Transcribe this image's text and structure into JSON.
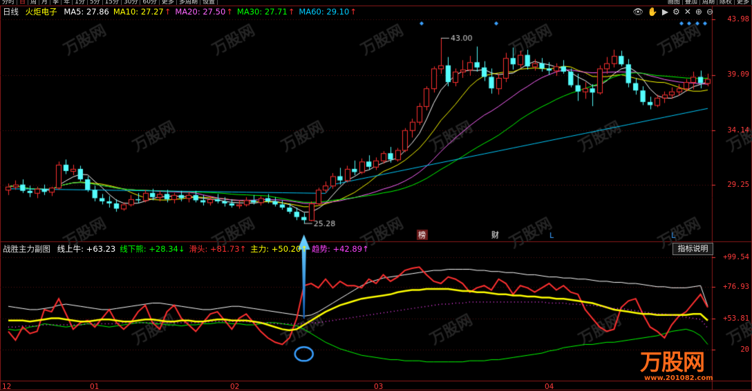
{
  "toolbar": {
    "tabs": [
      "分时",
      "日",
      "周",
      "月",
      "季",
      "年",
      "1分",
      "5分",
      "15分",
      "30分",
      "60分",
      "更多",
      "多周期",
      "设置"
    ],
    "active_index": 1,
    "right": [
      "画图",
      "叠加",
      "周期",
      "除权",
      "更多"
    ]
  },
  "main_panel": {
    "period_label": "日线",
    "stock_name": "火炬电子",
    "ma": [
      {
        "label": "MA5: 27.86",
        "color": "#ffffff"
      },
      {
        "label": "MA10: 27.27",
        "color": "#ffff00"
      },
      {
        "label": "MA20: 27.50",
        "color": "#ff66ff"
      },
      {
        "label": "MA30: 27.71",
        "color": "#00ff00"
      },
      {
        "label": "MA60: 29.10",
        "color": "#00ccff"
      }
    ],
    "up_arrow": "↑",
    "high_label": "43.00",
    "low_label": "25.28",
    "events": [
      "榜",
      "财",
      "L",
      "L"
    ],
    "y_ticks": [
      "43.98",
      "39.09",
      "34.14",
      "29.25"
    ]
  },
  "sub_panel": {
    "title": "战胜主力副图",
    "indicators": [
      {
        "label": "线上牛: +63.23",
        "color": "#ffffff"
      },
      {
        "label": "线下熊: +28.34",
        "color": "#00ff00",
        "arrow": "↓"
      },
      {
        "label": "滑头: +81.73",
        "color": "#ff3030",
        "arrow": "↑"
      },
      {
        "label": "主力: +50.20",
        "color": "#ffff00",
        "arrow": "↑"
      },
      {
        "label": "趋势: +42.89",
        "color": "#ff44ff",
        "arrow": "↑"
      }
    ],
    "help_button": "指标说明",
    "y_ticks": [
      "+99.54",
      "+76.93",
      "+53.81",
      "20"
    ]
  },
  "x_axis": [
    "12",
    "01",
    "02",
    "03",
    "04"
  ],
  "watermark": {
    "brand": "万股网",
    "url": "www.201082.com"
  },
  "colors": {
    "up": "#ff3030",
    "down": "#54fcfc",
    "axis": "#ff3b3b",
    "grid": "#8b1a1a"
  },
  "chart_data": [
    {
      "type": "candlestick",
      "title": "火炬电子 日线",
      "columns": [
        "open",
        "high",
        "low",
        "close"
      ],
      "candles": [
        [
          28.5,
          29.1,
          28.0,
          28.8
        ],
        [
          28.8,
          29.4,
          28.5,
          29.0
        ],
        [
          29.0,
          29.5,
          28.2,
          28.4
        ],
        [
          28.4,
          28.9,
          27.8,
          28.2
        ],
        [
          28.2,
          28.8,
          27.7,
          28.6
        ],
        [
          28.6,
          29.0,
          28.0,
          28.3
        ],
        [
          28.3,
          28.8,
          27.9,
          28.7
        ],
        [
          28.7,
          31.2,
          28.5,
          30.9
        ],
        [
          30.9,
          31.4,
          30.0,
          30.3
        ],
        [
          30.3,
          30.9,
          29.9,
          30.5
        ],
        [
          30.5,
          30.8,
          29.3,
          29.5
        ],
        [
          29.5,
          29.8,
          28.3,
          28.5
        ],
        [
          28.5,
          28.9,
          27.4,
          27.7
        ],
        [
          27.7,
          28.1,
          27.1,
          27.4
        ],
        [
          27.4,
          27.9,
          26.8,
          27.2
        ],
        [
          27.2,
          27.6,
          26.4,
          26.7
        ],
        [
          26.7,
          27.3,
          26.5,
          27.1
        ],
        [
          27.1,
          28.0,
          26.9,
          27.6
        ],
        [
          27.6,
          28.2,
          27.2,
          27.5
        ],
        [
          27.5,
          28.5,
          27.3,
          28.2
        ],
        [
          28.2,
          28.6,
          27.5,
          27.8
        ],
        [
          27.8,
          28.4,
          27.4,
          28.1
        ],
        [
          28.1,
          28.5,
          27.3,
          27.6
        ],
        [
          27.6,
          28.2,
          27.2,
          28.0
        ],
        [
          28.0,
          28.4,
          27.4,
          27.7
        ],
        [
          27.7,
          28.3,
          27.3,
          28.0
        ],
        [
          28.0,
          28.4,
          27.3,
          27.5
        ],
        [
          27.5,
          28.0,
          27.0,
          27.3
        ],
        [
          27.3,
          27.9,
          27.0,
          27.6
        ],
        [
          27.6,
          28.1,
          27.2,
          27.4
        ],
        [
          27.4,
          27.8,
          26.9,
          27.2
        ],
        [
          27.2,
          27.6,
          26.8,
          27.0
        ],
        [
          27.0,
          27.5,
          26.7,
          27.1
        ],
        [
          27.1,
          27.8,
          26.9,
          27.5
        ],
        [
          27.5,
          28.0,
          27.1,
          27.3
        ],
        [
          27.3,
          27.9,
          27.0,
          27.7
        ],
        [
          27.7,
          28.1,
          27.2,
          27.4
        ],
        [
          27.4,
          27.8,
          26.9,
          27.1
        ],
        [
          27.1,
          27.5,
          26.6,
          26.8
        ],
        [
          26.8,
          27.2,
          26.2,
          26.4
        ],
        [
          26.4,
          26.8,
          25.6,
          25.9
        ],
        [
          25.9,
          26.3,
          25.28,
          25.6
        ],
        [
          25.6,
          27.4,
          25.5,
          27.2
        ],
        [
          27.2,
          28.7,
          27.0,
          28.5
        ],
        [
          28.5,
          29.3,
          28.2,
          28.9
        ],
        [
          28.9,
          30.1,
          28.6,
          29.8
        ],
        [
          29.8,
          30.6,
          29.0,
          29.4
        ],
        [
          29.4,
          30.8,
          29.2,
          30.5
        ],
        [
          30.5,
          31.3,
          29.9,
          30.2
        ],
        [
          30.2,
          31.5,
          30.0,
          31.2
        ],
        [
          31.2,
          31.8,
          30.4,
          30.7
        ],
        [
          30.7,
          31.6,
          30.4,
          31.3
        ],
        [
          31.3,
          32.2,
          31.0,
          32.0
        ],
        [
          32.0,
          32.6,
          31.1,
          31.4
        ],
        [
          31.4,
          32.5,
          31.2,
          32.3
        ],
        [
          32.3,
          34.4,
          32.1,
          34.2
        ],
        [
          34.2,
          35.3,
          33.5,
          35.0
        ],
        [
          35.0,
          36.8,
          34.7,
          36.5
        ],
        [
          36.5,
          38.4,
          36.1,
          38.2
        ],
        [
          38.2,
          40.3,
          37.8,
          40.1
        ],
        [
          40.1,
          43.0,
          39.6,
          40.4
        ],
        [
          40.4,
          41.2,
          38.4,
          38.8
        ],
        [
          38.8,
          40.1,
          38.4,
          39.8
        ],
        [
          39.8,
          40.9,
          39.2,
          40.0
        ],
        [
          40.0,
          41.3,
          39.4,
          40.7
        ],
        [
          40.7,
          42.2,
          39.8,
          40.2
        ],
        [
          40.2,
          40.8,
          38.9,
          39.3
        ],
        [
          39.3,
          40.1,
          37.7,
          38.2
        ],
        [
          38.2,
          39.6,
          37.6,
          39.2
        ],
        [
          39.2,
          41.6,
          38.8,
          41.1
        ],
        [
          41.1,
          42.1,
          40.0,
          40.5
        ],
        [
          40.5,
          41.8,
          40.2,
          41.4
        ],
        [
          41.4,
          41.9,
          40.0,
          40.3
        ],
        [
          40.3,
          41.0,
          39.9,
          40.6
        ],
        [
          40.6,
          41.1,
          39.8,
          40.1
        ],
        [
          40.1,
          40.7,
          39.5,
          39.9
        ],
        [
          39.9,
          40.6,
          39.4,
          40.3
        ],
        [
          40.3,
          40.9,
          39.6,
          39.8
        ],
        [
          39.8,
          40.1,
          38.3,
          38.5
        ],
        [
          38.5,
          39.6,
          37.0,
          37.9
        ],
        [
          37.9,
          38.8,
          37.2,
          38.2
        ],
        [
          38.2,
          38.6,
          36.5,
          37.8
        ],
        [
          37.8,
          40.4,
          37.6,
          40.1
        ],
        [
          40.1,
          41.2,
          39.6,
          40.6
        ],
        [
          40.6,
          41.9,
          40.2,
          41.3
        ],
        [
          41.3,
          41.8,
          40.3,
          40.5
        ],
        [
          40.5,
          41.0,
          38.3,
          38.7
        ],
        [
          38.7,
          39.2,
          37.6,
          38.0
        ],
        [
          38.0,
          38.4,
          36.6,
          36.9
        ],
        [
          36.9,
          37.4,
          36.2,
          36.6
        ],
        [
          36.6,
          37.6,
          36.4,
          37.3
        ],
        [
          37.3,
          37.9,
          36.8,
          37.6
        ],
        [
          37.6,
          38.3,
          37.2,
          37.9
        ],
        [
          37.9,
          38.6,
          37.5,
          38.2
        ],
        [
          38.2,
          39.1,
          37.9,
          38.8
        ],
        [
          38.8,
          39.8,
          38.1,
          39.3
        ],
        [
          39.3,
          39.9,
          38.2,
          38.7
        ],
        [
          38.7,
          39.6,
          38.4,
          39.1
        ]
      ],
      "ma_series": [
        {
          "name": "MA5",
          "color": "#ffffff"
        },
        {
          "name": "MA10",
          "color": "#ffff00"
        },
        {
          "name": "MA20",
          "color": "#ff66ff"
        },
        {
          "name": "MA30",
          "color": "#00ff00"
        },
        {
          "name": "MA60",
          "color": "#00ccff"
        }
      ],
      "ylim": [
        23.9,
        45.2
      ]
    },
    {
      "type": "line",
      "title": "战胜主力副图",
      "series": [
        {
          "name": "线上牛",
          "color": "#ffffff",
          "values": [
            63,
            62,
            61,
            60,
            60,
            61,
            62,
            64,
            65,
            64,
            63,
            62,
            61,
            60,
            60,
            61,
            62,
            63,
            64,
            65,
            66,
            66,
            65,
            64,
            63,
            62,
            61,
            60,
            60,
            61,
            62,
            63,
            63,
            62,
            61,
            60,
            59,
            58,
            57,
            56,
            55,
            54,
            55,
            58,
            62,
            66,
            70,
            74,
            78,
            82,
            85,
            87,
            89,
            90,
            91,
            92,
            93,
            94,
            95,
            96,
            96,
            97,
            97,
            97,
            97,
            96,
            96,
            95,
            95,
            94,
            94,
            93,
            92,
            92,
            91,
            90,
            90,
            89,
            89,
            88,
            88,
            87,
            86,
            86,
            85,
            85,
            84,
            84,
            83,
            82,
            81,
            81,
            80,
            80,
            80,
            81,
            82,
            63
          ]
        },
        {
          "name": "线下熊",
          "color": "#00ff00",
          "values": [
            42,
            41,
            42,
            44,
            45,
            47,
            46,
            45,
            44,
            45,
            46,
            47,
            46,
            45,
            44,
            45,
            46,
            47,
            48,
            48,
            47,
            47,
            46,
            46,
            45,
            46,
            46,
            47,
            47,
            48,
            48,
            47,
            47,
            46,
            46,
            47,
            48,
            48,
            47,
            46,
            45,
            42,
            38,
            34,
            30,
            27,
            24,
            22,
            20,
            18,
            17,
            16,
            15,
            14,
            14,
            13,
            13,
            13,
            12,
            12,
            12,
            12,
            12,
            12,
            13,
            13,
            13,
            14,
            14,
            15,
            16,
            17,
            18,
            19,
            20,
            22,
            23,
            25,
            26,
            27,
            28,
            28,
            29,
            30,
            30,
            31,
            32,
            33,
            34,
            35,
            36,
            38,
            40,
            41,
            42,
            40,
            36,
            28
          ]
        },
        {
          "name": "滑头",
          "color": "#ff3030",
          "values": [
            40,
            32,
            44,
            38,
            40,
            60,
            58,
            70,
            56,
            42,
            48,
            50,
            44,
            52,
            60,
            48,
            42,
            48,
            58,
            64,
            48,
            42,
            58,
            64,
            52,
            46,
            40,
            48,
            56,
            58,
            50,
            42,
            52,
            56,
            48,
            40,
            34,
            30,
            28,
            34,
            52,
            82,
            84,
            80,
            88,
            80,
            86,
            82,
            82,
            80,
            88,
            84,
            92,
            86,
            90,
            96,
            98,
            99,
            92,
            86,
            84,
            90,
            88,
            84,
            76,
            80,
            82,
            78,
            88,
            84,
            74,
            82,
            80,
            76,
            80,
            84,
            78,
            82,
            76,
            74,
            60,
            52,
            44,
            40,
            42,
            62,
            68,
            70,
            56,
            44,
            40,
            34,
            46,
            54,
            58,
            66,
            74,
            62
          ]
        },
        {
          "name": "主力",
          "color": "#ffff00",
          "values": [
            50,
            50,
            50,
            49,
            50,
            51,
            52,
            52,
            51,
            50,
            49,
            49,
            50,
            51,
            51,
            50,
            49,
            49,
            50,
            51,
            51,
            50,
            49,
            49,
            50,
            50,
            49,
            49,
            50,
            51,
            51,
            50,
            50,
            50,
            49,
            48,
            46,
            44,
            42,
            41,
            42,
            46,
            50,
            54,
            58,
            61,
            64,
            66,
            68,
            70,
            71,
            72,
            73,
            74,
            76,
            77,
            78,
            78,
            79,
            79,
            79,
            79,
            78,
            77,
            77,
            76,
            76,
            75,
            74,
            74,
            73,
            73,
            72,
            72,
            71,
            71,
            70,
            70,
            69,
            68,
            67,
            66,
            64,
            62,
            60,
            59,
            58,
            57,
            56,
            56,
            55,
            55,
            55,
            55,
            55,
            56,
            56,
            50
          ]
        },
        {
          "name": "趋势",
          "color": "#ff44ff",
          "values": [
            44,
            44,
            45,
            45,
            45,
            46,
            46,
            46,
            46,
            46,
            46,
            47,
            47,
            47,
            47,
            47,
            48,
            48,
            48,
            48,
            48,
            48,
            48,
            48,
            48,
            48,
            48,
            48,
            49,
            49,
            49,
            49,
            49,
            49,
            48,
            48,
            48,
            47,
            47,
            47,
            47,
            47,
            48,
            48,
            49,
            50,
            51,
            52,
            53,
            54,
            55,
            56,
            57,
            58,
            59,
            60,
            61,
            62,
            63,
            64,
            65,
            65,
            66,
            66,
            67,
            67,
            67,
            67,
            67,
            67,
            67,
            67,
            67,
            67,
            67,
            66,
            66,
            66,
            65,
            65,
            64,
            64,
            63,
            62,
            61,
            61,
            60,
            59,
            58,
            57,
            56,
            56,
            55,
            54,
            53,
            52,
            51,
            43
          ]
        }
      ],
      "ylim": [
        -4,
        110
      ]
    }
  ]
}
